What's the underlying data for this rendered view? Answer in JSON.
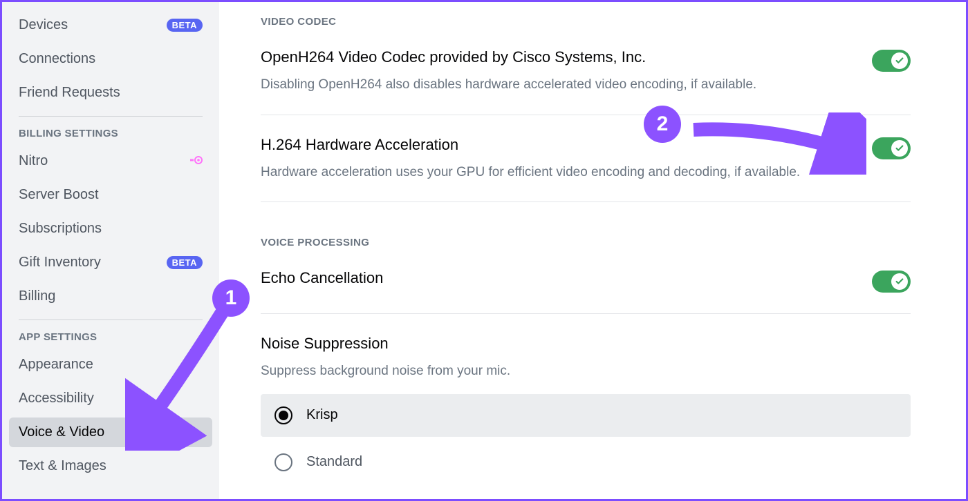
{
  "sidebar": {
    "section_user": [
      {
        "label": "Devices",
        "badge": "BETA"
      },
      {
        "label": "Connections"
      },
      {
        "label": "Friend Requests"
      }
    ],
    "billing_heading": "BILLING SETTINGS",
    "section_billing": [
      {
        "label": "Nitro",
        "nitro": true
      },
      {
        "label": "Server Boost"
      },
      {
        "label": "Subscriptions"
      },
      {
        "label": "Gift Inventory",
        "badge": "BETA"
      },
      {
        "label": "Billing"
      }
    ],
    "app_heading": "APP SETTINGS",
    "section_app": [
      {
        "label": "Appearance"
      },
      {
        "label": "Accessibility"
      },
      {
        "label": "Voice & Video",
        "active": true
      },
      {
        "label": "Text & Images"
      }
    ]
  },
  "main": {
    "video_codec_heading": "VIDEO CODEC",
    "openh264": {
      "title": "OpenH264 Video Codec provided by Cisco Systems, Inc.",
      "desc": "Disabling OpenH264 also disables hardware accelerated video encoding, if available."
    },
    "h264": {
      "title": "H.264 Hardware Acceleration",
      "desc": "Hardware acceleration uses your GPU for efficient video encoding and decoding, if available."
    },
    "voice_heading": "VOICE PROCESSING",
    "echo": {
      "title": "Echo Cancellation"
    },
    "noise": {
      "title": "Noise Suppression",
      "desc": "Suppress background noise from your mic.",
      "options": {
        "krisp": "Krisp",
        "standard": "Standard"
      }
    }
  },
  "annotations": {
    "one": "1",
    "two": "2"
  }
}
